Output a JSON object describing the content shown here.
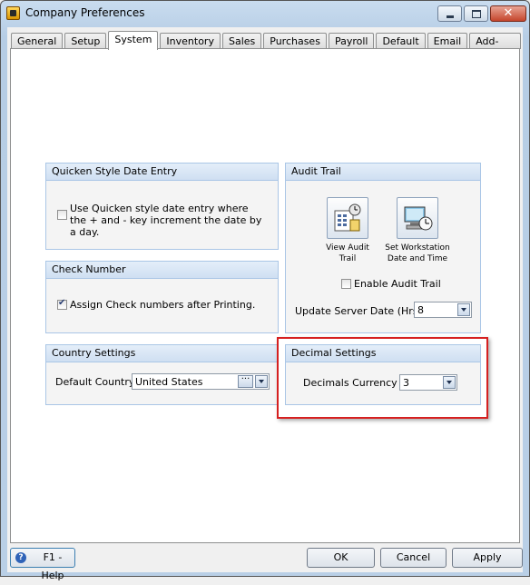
{
  "window": {
    "title": "Company Preferences"
  },
  "tabs": [
    "General",
    "Setup",
    "System",
    "Inventory",
    "Sales",
    "Purchases",
    "Payroll",
    "Default",
    "Email",
    "Add-Ons"
  ],
  "active_tab": "System",
  "quicken": {
    "title": "Quicken Style Date Entry",
    "checkbox_label": "Use Quicken style date entry where the + and - key increment the date by a day.",
    "checked": false
  },
  "check_number": {
    "title": "Check Number",
    "checkbox_label": "Assign Check numbers after Printing.",
    "checked": true
  },
  "country": {
    "title": "Country Settings",
    "label": "Default Country",
    "value": "United States"
  },
  "audit": {
    "title": "Audit Trail",
    "view_label_1": "View Audit",
    "view_label_2": "Trail",
    "workstation_label_1": "Set Workstation",
    "workstation_label_2": "Date and Time",
    "enable_label": "Enable Audit Trail",
    "enable_checked": false,
    "server_date_label": "Update Server Date (Hrs)",
    "server_date_value": "8"
  },
  "decimal": {
    "title": "Decimal Settings",
    "label": "Decimals Currency",
    "value": "3"
  },
  "footer": {
    "help": "F1 - Help",
    "ok": "OK",
    "cancel": "Cancel",
    "apply": "Apply"
  },
  "icons": {
    "help": "help-icon",
    "audit": "audit-trail-icon",
    "workstation": "workstation-clock-icon"
  },
  "colors": {
    "highlight": "#d62020",
    "group_header": "#cfdff2"
  }
}
